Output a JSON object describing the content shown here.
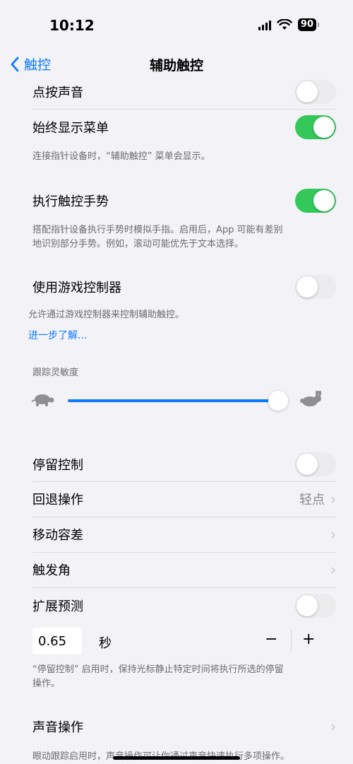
{
  "status": {
    "time": "10:12",
    "battery": "90"
  },
  "nav": {
    "back_label": "触控",
    "title": "辅助触控"
  },
  "rows": {
    "click_sound": "点按声音",
    "always_show_menu": "始终显示菜单",
    "perform_gestures": "执行触控手势",
    "use_game_controller": "使用游戏控制器",
    "dwell_control": "停留控制",
    "fallback_action": "回退操作",
    "fallback_action_value": "轻点",
    "movement_tolerance": "移动容差",
    "hot_corners": "触发角",
    "extended_prediction": "扩展预测",
    "sound_actions": "声音操作"
  },
  "footnotes": {
    "always_show_menu": "连接指针设备时，“辅助触控” 菜单会显示。",
    "perform_gestures": "搭配指针设备执行手势时模拟手指。启用后，App 可能有差别地识别部分手势。例如，滚动可能优先于文本选择。",
    "game_controller": "允许通过游戏控制器来控制辅助触控。",
    "dwell_control": "“停留控制” 启用时，保持光标静止特定时间将执行所选的停留操作。",
    "sound_actions": "眼动跟踪启用时，声音操作可让你通过声音快速执行多项操作。"
  },
  "learn_more": "进一步了解...",
  "tracking_sensitivity": {
    "label": "跟踪灵敏度",
    "value": 0.93
  },
  "dwell": {
    "value": "0.65",
    "unit": "秒",
    "minus": "−",
    "plus": "+"
  },
  "toggles": {
    "click_sound": false,
    "always_show_menu": true,
    "perform_gestures": true,
    "use_game_controller": false,
    "dwell_control": false,
    "extended_prediction": false
  },
  "colors": {
    "accent": "#0a7aff",
    "toggle_on": "#34c759",
    "background": "#f2f2f7"
  }
}
